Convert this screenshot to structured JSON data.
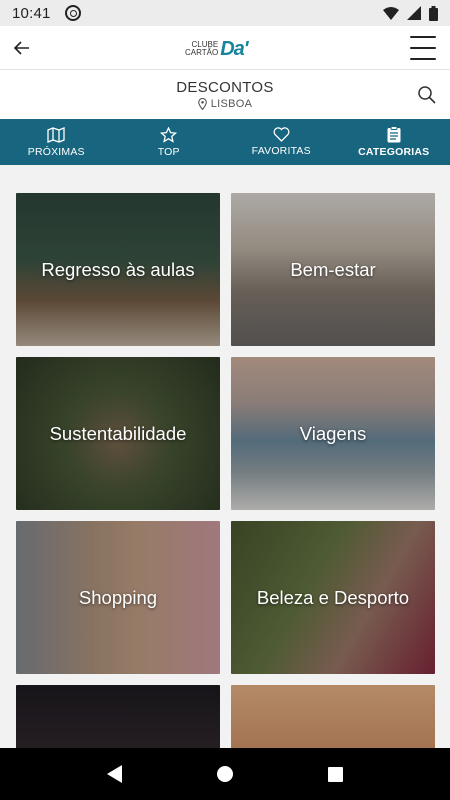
{
  "status_bar": {
    "time": "10:41"
  },
  "app_bar": {
    "logo_line1": "CLUBE",
    "logo_line2": "CARTÃO",
    "logo_mark": "Da'"
  },
  "header": {
    "title": "DESCONTOS",
    "location": "LISBOA"
  },
  "tabs": [
    {
      "label": "PRÓXIMAS",
      "icon": "map-icon",
      "active": false
    },
    {
      "label": "TOP",
      "icon": "star-icon",
      "active": false
    },
    {
      "label": "FAVORITAS",
      "icon": "heart-icon",
      "active": false
    },
    {
      "label": "CATEGORIAS",
      "icon": "clipboard-icon",
      "active": true
    }
  ],
  "categories": [
    {
      "label": "Regresso às aulas",
      "color": "#3f5a4a"
    },
    {
      "label": "Bem-estar",
      "color": "#a79b8e"
    },
    {
      "label": "Sustentabilidade",
      "color": "#4a5a38"
    },
    {
      "label": "Viagens",
      "color": "#7d8b96"
    },
    {
      "label": "Shopping",
      "color": "#a58a78"
    },
    {
      "label": "Beleza e Desporto",
      "color": "#5a6a3e"
    },
    {
      "label": "",
      "color": "#2e2a30"
    },
    {
      "label": "",
      "color": "#c98a62"
    }
  ],
  "colors": {
    "accent": "#17657e",
    "brand": "#17849d"
  }
}
